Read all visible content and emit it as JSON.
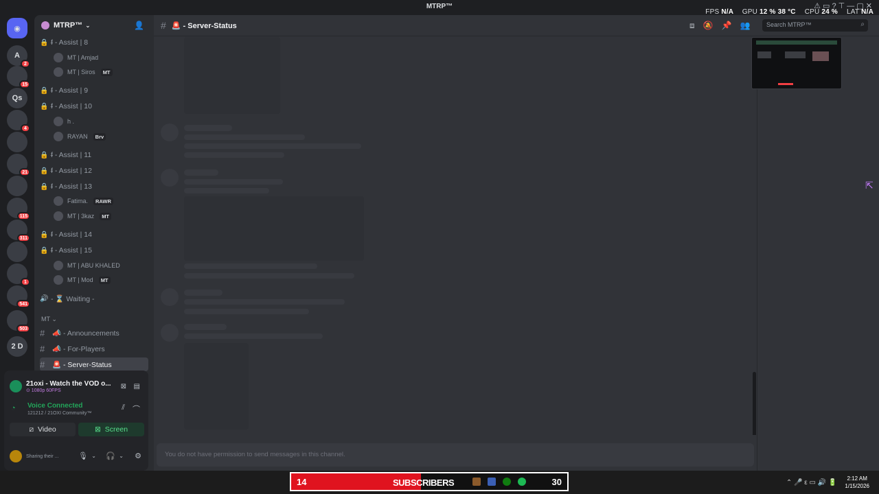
{
  "window": {
    "title": "MTRP™",
    "controls": "⚠ ▭ ? ⊤ — ▢ ✕"
  },
  "stats": {
    "fps_label": "FPS",
    "fps": "N/A",
    "gpu_label": "GPU",
    "gpu": "12 %",
    "gpu_temp": "38 °C",
    "cpu_label": "CPU",
    "cpu": "24 %",
    "lat_label": "LAT",
    "lat": "N/A"
  },
  "servers": [
    {
      "label": "A",
      "badge": "2"
    },
    {
      "label": "",
      "badge": "15"
    },
    {
      "label": "Qs",
      "badge": ""
    },
    {
      "label": "",
      "badge": "4"
    },
    {
      "label": "",
      "badge": ""
    },
    {
      "label": "",
      "badge": "21"
    },
    {
      "label": "",
      "badge": ""
    },
    {
      "label": "",
      "badge": "115"
    },
    {
      "label": "",
      "badge": "311"
    },
    {
      "label": "",
      "badge": ""
    },
    {
      "label": "",
      "badge": "1"
    },
    {
      "label": "",
      "badge": "541"
    },
    {
      "label": "",
      "badge": "503"
    },
    {
      "label": "2 D",
      "badge": ""
    }
  ],
  "guild": {
    "name": "MTRP™"
  },
  "channels": [
    {
      "icon": "🔒",
      "name": "ᵮ - Assist | 8",
      "green": true
    },
    {
      "icon": "🔒",
      "name": "ᵮ - Assist | 9",
      "green": false
    },
    {
      "icon": "🔒",
      "name": "ᵮ - Assist | 10",
      "green": true
    },
    {
      "icon": "🔒",
      "name": "ᵮ - Assist | 11",
      "green": false
    },
    {
      "icon": "🔒",
      "name": "ᵮ - Assist | 12",
      "green": false
    },
    {
      "icon": "🔒",
      "name": "ᵮ - Assist | 13",
      "green": true
    },
    {
      "icon": "🔒",
      "name": "ᵮ - Assist | 14",
      "green": false
    },
    {
      "icon": "🔒",
      "name": "ᵮ - Assist | 15",
      "green": true
    },
    {
      "icon": "🔊",
      "name": "- ⌛ Waiting -",
      "green": false
    }
  ],
  "users": [
    {
      "name": "MT | Amjad",
      "tag": ""
    },
    {
      "name": "MT | Siros",
      "tag": "MT"
    },
    {
      "name": "h .",
      "tag": ""
    },
    {
      "name": "RAYAN",
      "tag": "Brv"
    },
    {
      "name": "Fatima.",
      "tag": "RAWR"
    },
    {
      "name": "MT | 3kaz",
      "tag": "MT"
    },
    {
      "name": "MT | ABU KHALED",
      "tag": ""
    },
    {
      "name": "MT | Mod",
      "tag": "MT"
    }
  ],
  "category": "MT ⌄",
  "text_channels": [
    {
      "name": "📣 - Announcements"
    },
    {
      "name": "📣 - For-Players"
    },
    {
      "name": "🚨 - Server-Status"
    }
  ],
  "stream": {
    "title": "21oxi - Watch the VOD o...",
    "sub": "⊙ 1080p 60FPS"
  },
  "voice": {
    "status": "Voice Connected",
    "server": "121212 / 21OXI Community™"
  },
  "buttons": {
    "video": "Video",
    "screen": "Screen"
  },
  "user_panel": {
    "status": "Sharing their ..."
  },
  "topbar": {
    "channel": "🚨 - Server-Status",
    "search_placeholder": "Search MTRP™"
  },
  "composer": {
    "text": "You do not have permission to send messages in this channel."
  },
  "subscribers": {
    "current": "14",
    "label": "SUBSCRIBERS",
    "goal": "30",
    "progress": 0.47
  },
  "clock": {
    "time": "2:12 AM",
    "date": "1/15/2026"
  },
  "tray": {
    "icons": "⌃  🎤  ε  ▭  🔊  🔋"
  }
}
